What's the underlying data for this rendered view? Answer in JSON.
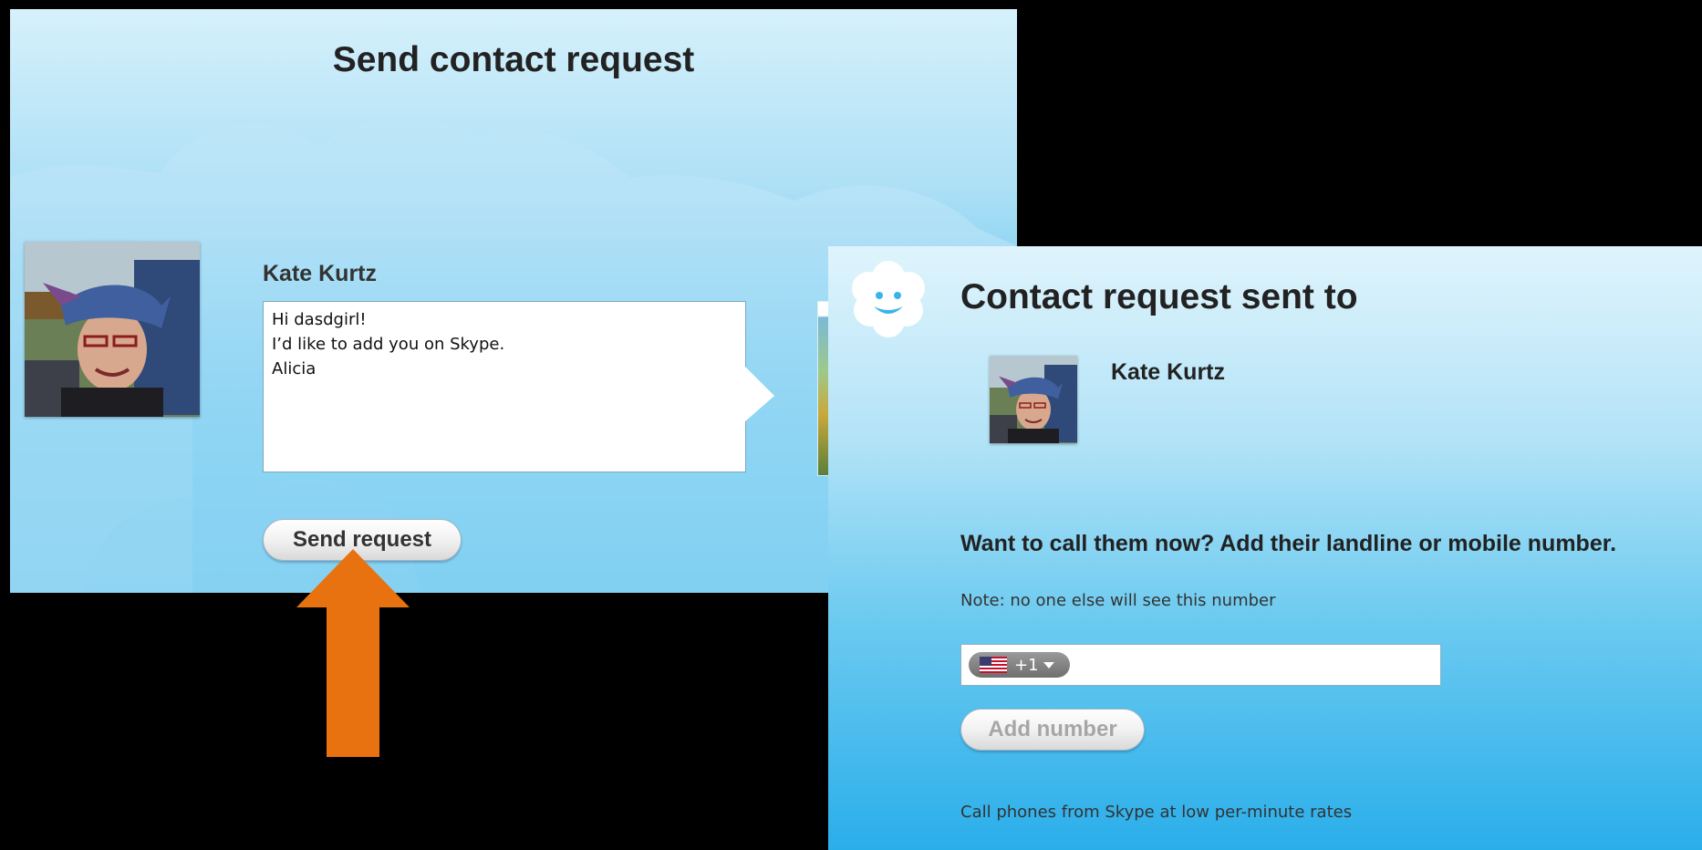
{
  "send_panel": {
    "title": "Send contact request",
    "contact_name": "Kate Kurtz",
    "message": "Hi dasdgirl!\nI’d like to add you on Skype.\nAlicia",
    "send_button_label": "Send request"
  },
  "sent_panel": {
    "title": "Contact request sent to",
    "contact_name": "Kate Kurtz",
    "call_prompt": "Want to call them now? Add their landline or mobile number.",
    "note": "Note: no one else will see this number",
    "phone": {
      "country_flag_icon": "us-flag-icon",
      "dial_code": "+1",
      "value": ""
    },
    "add_number_button_label": "Add number",
    "footer": "Call phones from Skype at low per-minute rates"
  },
  "annotation": {
    "arrow_color": "#e8720f"
  },
  "colors": {
    "sky_top": "#d6f1fb",
    "sky_bottom": "#33b6ec",
    "title_text": "#222222"
  }
}
